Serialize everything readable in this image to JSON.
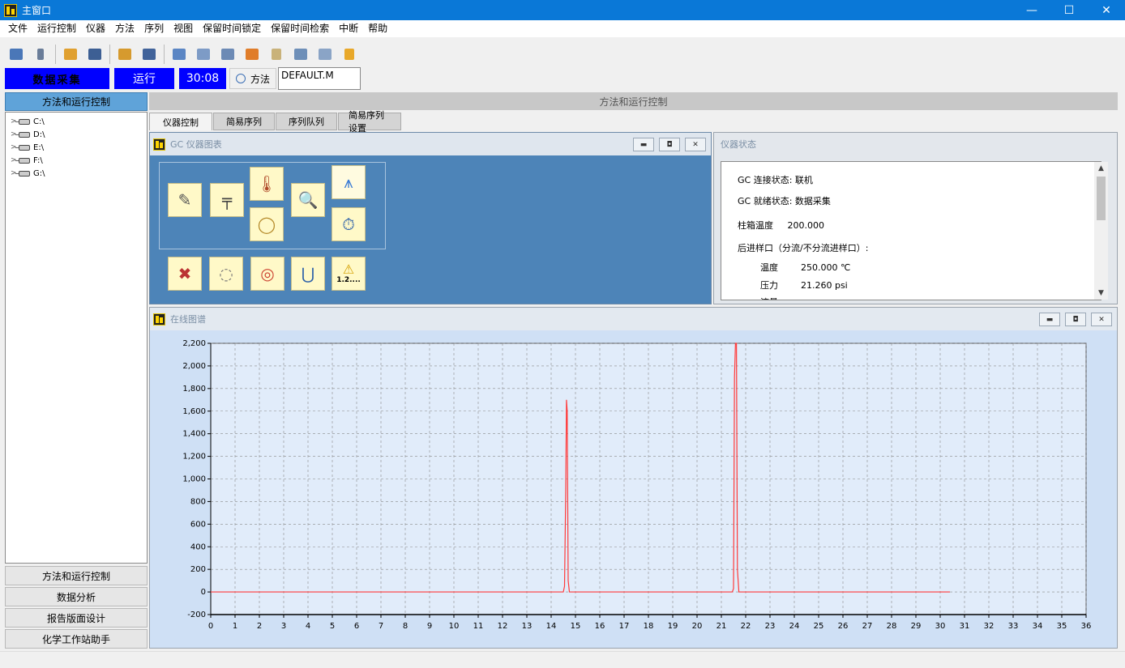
{
  "window": {
    "title": "主窗口",
    "controls": {
      "minimize": "—",
      "maximize": "☐",
      "close": "✕"
    }
  },
  "menu": [
    "文件",
    "运行控制",
    "仪器",
    "方法",
    "序列",
    "视图",
    "保留时间锁定",
    "保留时间检索",
    "中断",
    "帮助"
  ],
  "toolbar": {
    "icons": [
      "sequence-icon",
      "method-icon",
      "load-icon",
      "save-icon",
      "load-sequence-icon",
      "save-sequence-icon",
      "report-icon",
      "print-icon",
      "edit-icon",
      "book-icon",
      "flask-icon",
      "syringe-icon",
      "tools-icon",
      "lamp-icon"
    ]
  },
  "status": {
    "acquisition": "数据采集",
    "run": "运行",
    "time": "30:08",
    "method_label": "方法",
    "method_name": "DEFAULT.M"
  },
  "nav": {
    "header": "方法和运行控制",
    "drives": [
      "C:\\",
      "D:\\",
      "E:\\",
      "F:\\",
      "G:\\"
    ],
    "buttons": [
      "方法和运行控制",
      "数据分析",
      "报告版面设计",
      "化学工作站助手"
    ]
  },
  "main": {
    "header": "方法和运行控制",
    "tabs": [
      "仪器控制",
      "简易序列",
      "序列队列",
      "简易序列设置"
    ],
    "active_tab": 0
  },
  "gc_panel": {
    "title": "GC 仪器图表",
    "icons": [
      "injector-icon",
      "inlet-icon",
      "oven-icon",
      "column-icon",
      "detector-icon",
      "signal-icon",
      "valve-timer-icon",
      "tools-icon",
      "column-ring-icon",
      "gauge-icon",
      "magnet-icon",
      "warning-icon"
    ],
    "warning_text": "1.2...."
  },
  "status_panel": {
    "title": "仪器状态",
    "lines": [
      "GC 连接状态: 联机",
      "GC 就绪状态: 数据采集",
      "柱箱温度     200.000",
      "后进样口（分流/不分流进样口）:",
      "温度        250.000 ℃",
      "压力        21.260 psi",
      "流量"
    ]
  },
  "chrom_panel": {
    "title": "在线图谱"
  },
  "colors": {
    "titlebar": "#0a78d7",
    "status_blue": "#0000ff",
    "panel_blue": "#4d84b8",
    "plot_bg": "#cfe0f5",
    "trace": "#ff3a3a"
  },
  "chart_data": {
    "type": "line",
    "xlabel": "",
    "ylabel": "",
    "xlim": [
      0,
      36
    ],
    "ylim": [
      -200,
      2200
    ],
    "x_ticks": [
      0,
      1,
      2,
      3,
      4,
      5,
      6,
      7,
      8,
      9,
      10,
      11,
      12,
      13,
      14,
      15,
      16,
      17,
      18,
      19,
      20,
      21,
      22,
      23,
      24,
      25,
      26,
      27,
      28,
      29,
      30,
      31,
      32,
      33,
      34,
      35,
      36
    ],
    "y_ticks": [
      -200,
      0,
      200,
      400,
      600,
      800,
      1000,
      1200,
      1400,
      1600,
      1800,
      2000,
      2200
    ],
    "y_tick_labels": [
      "-200",
      "0",
      "200",
      "400",
      "600",
      "800",
      "1,000",
      "1,200",
      "1,400",
      "1,600",
      "1,800",
      "2,000",
      "2,200"
    ],
    "grid": true,
    "series": [
      {
        "x": [
          0,
          14.5,
          14.55,
          14.6,
          14.63,
          14.66,
          14.7,
          14.75,
          21.45,
          21.5,
          21.54,
          21.58,
          21.62,
          21.66,
          21.72,
          30.4
        ],
        "y": [
          0,
          0,
          50,
          900,
          1700,
          1600,
          100,
          0,
          0,
          30,
          1900,
          2200,
          2200,
          200,
          0,
          0
        ]
      }
    ]
  }
}
